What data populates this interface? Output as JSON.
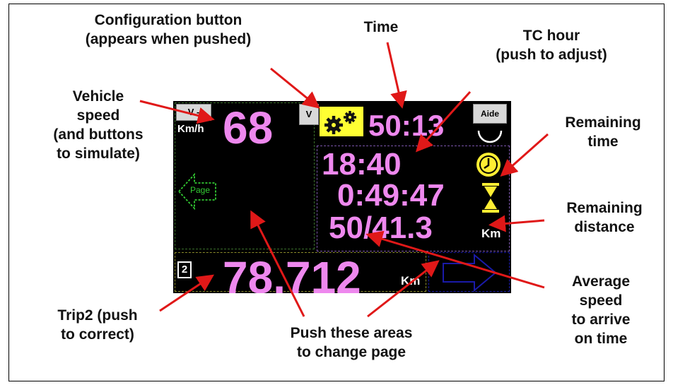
{
  "annotations": {
    "config_button": "Configuration button\n(appears when pushed)",
    "time": "Time",
    "tc_hour": "TC hour\n(push to adjust)",
    "vehicle_speed": "Vehicle\nspeed\n(and buttons\nto simulate)",
    "remaining_time": "Remaining\ntime",
    "remaining_distance": "Remaining\ndistance",
    "average_speed": "Average\nspeed\nto arrive\non time",
    "trip2": "Trip2 (push\nto correct)",
    "push_areas": "Push these areas\nto change page"
  },
  "screen": {
    "v_minus_label": "V -",
    "v_plus_label": "V",
    "aide_label": "Aide",
    "speed_value": "68",
    "speed_unit": "Km/h",
    "time_value": "50:13",
    "tc_hour_value": "18:40",
    "remaining_time_value": "0:49:47",
    "avg_distance_value": "50/41.3",
    "distance_unit": "Km",
    "page_label": "Page",
    "trip_number": "2",
    "trip_value": "78.712",
    "trip_unit": "Km"
  },
  "colors": {
    "value_color": "#ee88ee",
    "gear_bg": "#ffff33",
    "screen_bg": "#000000",
    "arrow_color": "#e01818",
    "page_arrow_green": "#33cc33",
    "page_arrow_blue": "#1a1aa8"
  },
  "icons": [
    "gear-icon",
    "clock-icon",
    "hourglass-icon",
    "page-left-arrow-icon",
    "page-right-arrow-icon"
  ]
}
